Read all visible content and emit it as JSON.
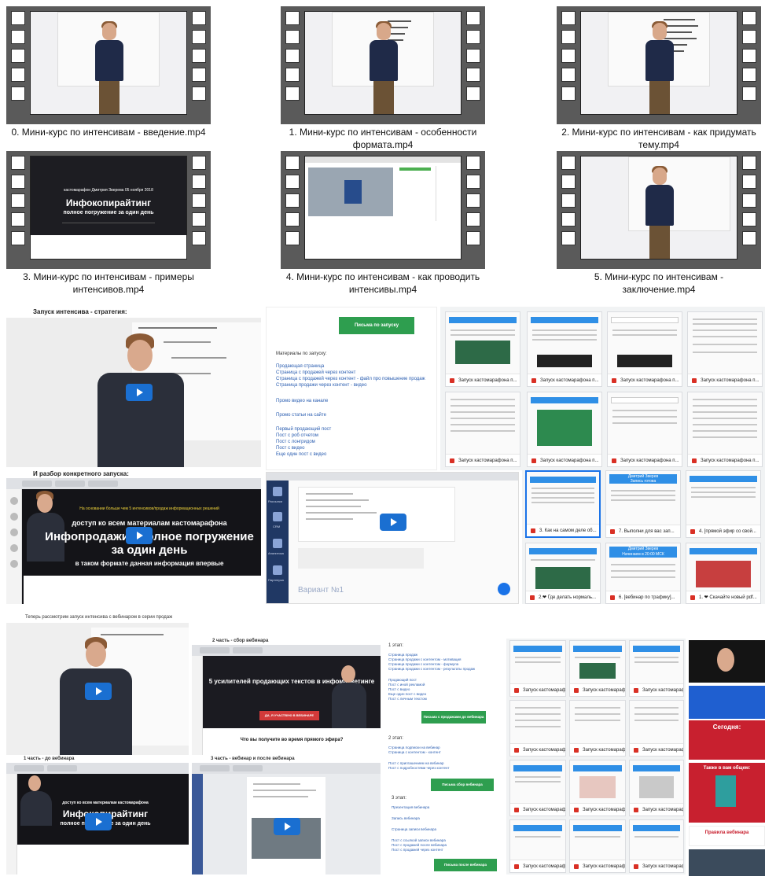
{
  "videos": [
    {
      "caption": "0. Мини-курс по интенсивам - введение.mp4"
    },
    {
      "caption": "1. Мини-курс по интенсивам - особенности формата.mp4"
    },
    {
      "caption": "2. Мини-курс по интенсивам - как придумать тему.mp4"
    },
    {
      "caption": "3. Мини-курс по интенсивам - примеры интенсивов.mp4"
    },
    {
      "caption": "4. Мини-курс по интенсивам - как проводить интенсивы.mp4"
    },
    {
      "caption": "5. Мини-курс по интенсивам - заключение.mp4"
    }
  ],
  "thumb_texts": {
    "v3_line1": "кастомарафон Дмитрия Зверева 05 ноября 2018",
    "v3_title": "Инфокопирайтинг",
    "v3_sub": "полное погружение за один день"
  },
  "gallery": {
    "strategy_heading": "Запуск интенсива - стратегия:",
    "analysis_heading": "И разбор конкретного запуска:",
    "launch_button": "Письма по запуску",
    "materials_title": "Материалы по запуску:",
    "materials_links": [
      "Продающая страница",
      "Страница с продажей через контент",
      "Страница с продажей через контент - файл про повышение продаж",
      "Страница продажи через контент - видео"
    ],
    "video_channel_link": "Промо видео на канале",
    "video_site_link": "Промо статьи на сайте",
    "posts_links": [
      "Первый продающий пост",
      "Пост с роб отчетом",
      "Пост с лонгридом",
      "Пост с видео",
      "Еще один пост с видео"
    ],
    "slide_top": "На основании больше чем 5 интенсивов/продаж информационных решений",
    "slide_access": "доступ ко всем материалам кастомарафона",
    "slide_title": "Инфопродажи - полное погружение за один день",
    "slide_format": "в таком формате данная информация впервые",
    "crm_labels": [
      "Рассылки",
      "CRM",
      "Аналитика",
      "Партнерка"
    ],
    "variant_label": "Вариант №1",
    "drive_labels": [
      "Запуск кастомарафона п...",
      "Запуск кастомарафона п...",
      "Запуск кастомарафона п...",
      "Запуск кастомарафона п...",
      "Запуск кастомарафона п...",
      "Запуск кастомарафона п...",
      "3. Как на самом деле об...",
      "7. Выполни для вас зап...",
      "4. [прямой эфир со свой...",
      "2.❤ Где делать нормаль...",
      "6. [вебинар по трафику]...",
      "1. ❤ Скачайте новый pdf..."
    ],
    "dmitry_name": "Дмитрий Зверев",
    "dmitry_ready": "Запись готова",
    "dmitry_start": "Начинаем в 20:00 МСК",
    "webinar_section_caption": "Теперь рассмотрим запуск интенсива с вебинаром в серии продаж",
    "part1_label": "1 часть - до вебинара",
    "part2_label": "2 часть - сбор вебинара",
    "part3_label": "3 часть - вебинар и после вебинара",
    "webinar_title": "5 усилителей продающих текстов в инфомаркетинге",
    "webinar_cta": "ДА, Я УЧАСТВУЮ В ВЕБИНАРЕ",
    "webinar_question": "Что вы получите во время прямого эфира?",
    "stages": [
      {
        "title": "1 этап:",
        "links": [
          "Страница продаж",
          "Страница продажи с контентом - мотивация",
          "Страница продажи с контентом - формула",
          "Страница продажи с контентом - результаты продаж"
        ],
        "links2": [
          "Продающий пост",
          "Пост с иной рекламой",
          "Пост с видео",
          "Еще один пост с видео",
          "Пост с личным текстом"
        ],
        "button": "Письма с продажами до вебинара"
      },
      {
        "title": "2 этап:",
        "links": [
          "Страница подписки на вебинар",
          "Страница с контентом - контент"
        ],
        "links2": [
          "Пост с приглашением на вебинар",
          "Пост с подробностями через контент"
        ],
        "button": "Письма сбор вебинара"
      },
      {
        "title": "3 этап:",
        "links": [
          "Презентация вебинара",
          "Запись вебинара",
          "Страница записи вебинара"
        ],
        "links2": [
          "Пост с ссылкой записи вебинара",
          "Пост с продажей после вебинара",
          "Пост с продажей через контент"
        ],
        "button": "Письма после вебинара"
      }
    ],
    "poster_heading": "Сегодня:",
    "poster_also": "Также в вам общем:",
    "poster_rules": "Правила вебинара"
  },
  "colors": {
    "film": "#5a5a5a",
    "accent_blue": "#1a6fd1",
    "green": "#2e9e4f",
    "poster_red": "#c8202f"
  }
}
